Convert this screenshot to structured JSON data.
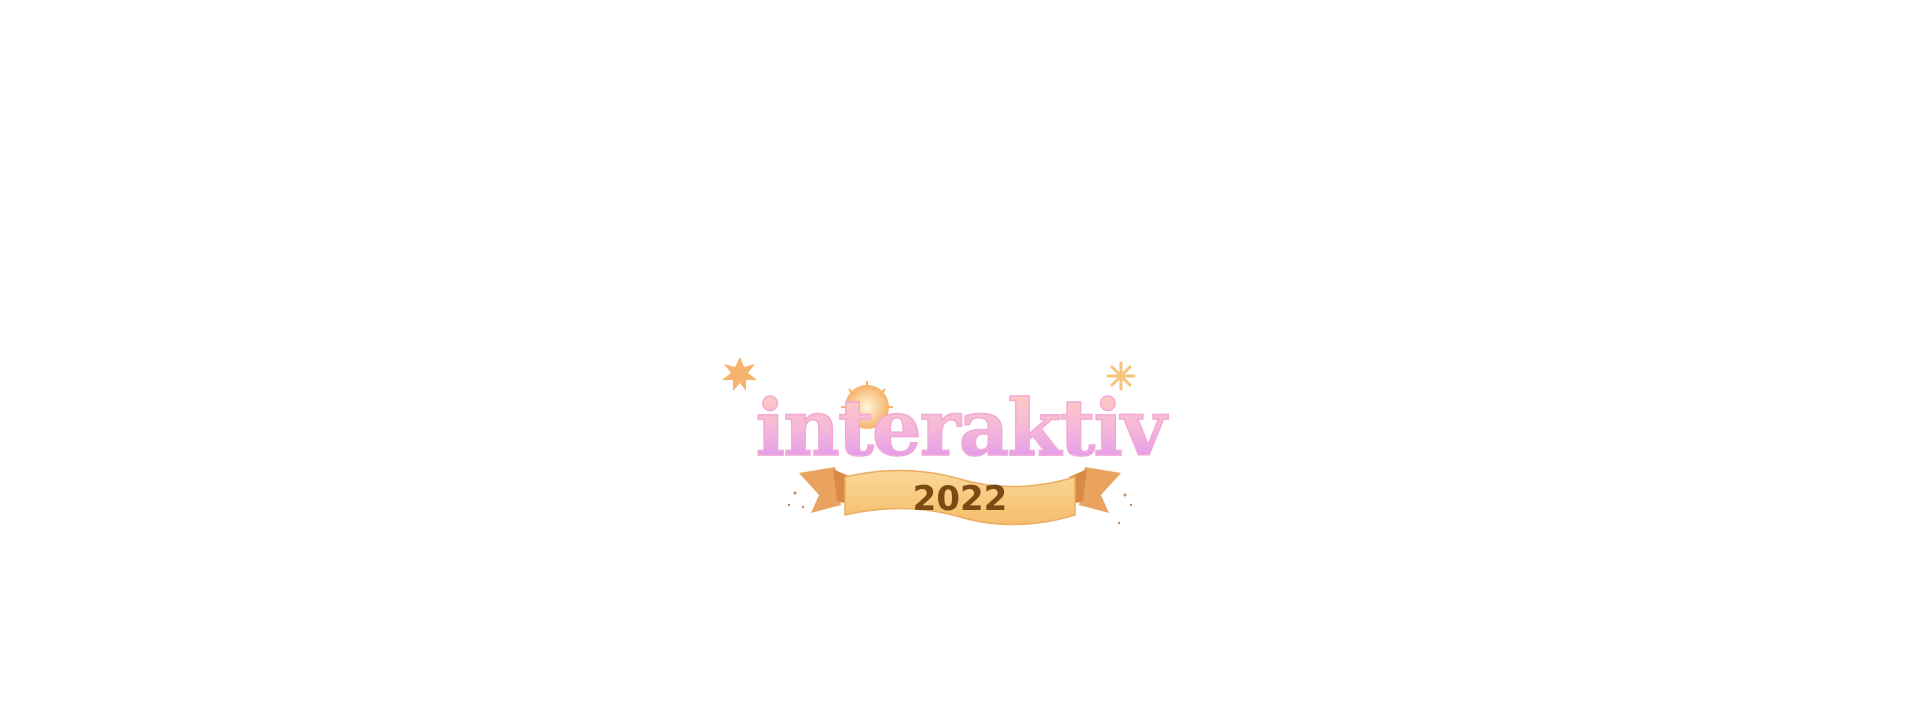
{
  "logo": {
    "wordmark": "interaktiv",
    "year": "2022",
    "colors": {
      "letters_top": "#ffc9b5",
      "letters_mid": "#f7b7d7",
      "letters_bottom": "#d58cf5",
      "ribbon": "#f7c77b",
      "ribbon_shadow": "#e99c5a",
      "year_text": "#7a4a12",
      "star": "#f6b36c"
    },
    "icons": [
      "star-icon",
      "sun-icon",
      "sparkle-icon",
      "ribbon-banner"
    ]
  }
}
